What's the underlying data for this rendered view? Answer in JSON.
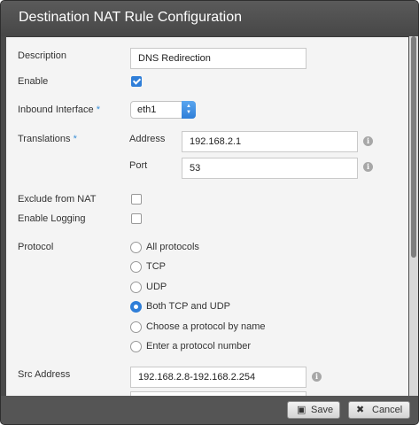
{
  "dialog": {
    "title": "Destination NAT Rule Configuration"
  },
  "form": {
    "description": {
      "label": "Description",
      "value": "DNS Redirection"
    },
    "enable": {
      "label": "Enable",
      "checked": true
    },
    "inbound_interface": {
      "label": "Inbound Interface",
      "required_mark": "*",
      "value": "eth1"
    },
    "translations": {
      "label": "Translations",
      "required_mark": "*",
      "address": {
        "label": "Address",
        "value": "192.168.2.1"
      },
      "port": {
        "label": "Port",
        "value": "53"
      }
    },
    "exclude_from_nat": {
      "label": "Exclude from NAT",
      "checked": false
    },
    "enable_logging": {
      "label": "Enable Logging",
      "checked": false
    },
    "protocol": {
      "label": "Protocol",
      "options": [
        "All protocols",
        "TCP",
        "UDP",
        "Both TCP and UDP",
        "Choose a protocol by name",
        "Enter a protocol number"
      ],
      "selected": "Both TCP and UDP"
    },
    "src_address": {
      "label": "Src Address",
      "value": "192.168.2.8-192.168.2.254"
    }
  },
  "footer": {
    "save_label": "Save",
    "cancel_label": "Cancel"
  },
  "icons": {
    "info": "info-icon",
    "save": "floppy-disk-icon",
    "cancel": "x-icon"
  },
  "colors": {
    "accent": "#2f7ed8",
    "titlebar": "#4a4a4a",
    "panel": "#f4f4f4"
  }
}
